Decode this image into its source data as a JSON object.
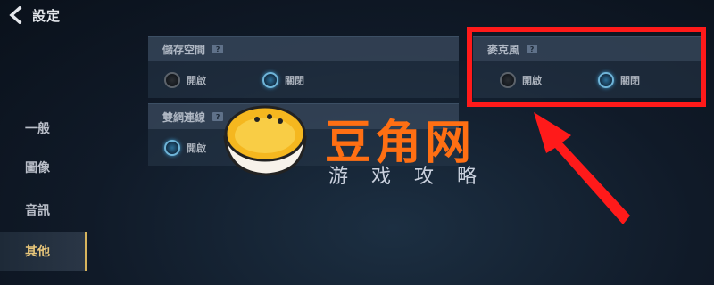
{
  "header": {
    "title": "設定"
  },
  "sidebar": {
    "items": [
      {
        "label": "一般"
      },
      {
        "label": "圖像"
      },
      {
        "label": "音訊"
      },
      {
        "label": "其他"
      }
    ],
    "active_index": 3
  },
  "panels": {
    "storage": {
      "title": "儲存空間",
      "help": "?",
      "option1": "開啟",
      "option2": "關閉",
      "selected": "關閉"
    },
    "microphone": {
      "title": "麥克風",
      "help": "?",
      "option1": "開啟",
      "option2": "關閉",
      "selected": "關閉"
    },
    "dual_network": {
      "title": "雙網連線",
      "help": "?",
      "option1": "開啟",
      "selected": "開啟"
    }
  },
  "watermark": {
    "title": "豆角网",
    "subtitle": "游戏攻略"
  },
  "colors": {
    "highlight": "#ff1a1a",
    "accent": "#d7b45d",
    "watermark": "#ff6f13"
  }
}
